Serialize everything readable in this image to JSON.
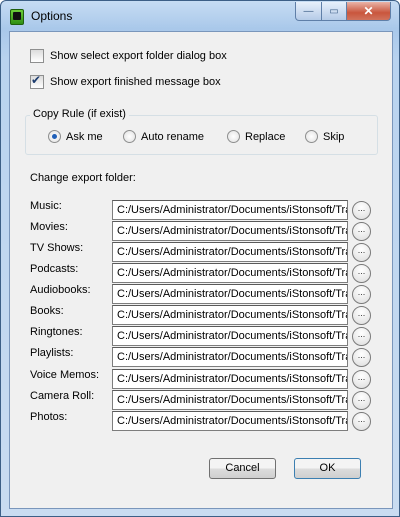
{
  "window": {
    "title": "Options"
  },
  "caption": {
    "minimize": "—",
    "maximize": "▭",
    "close": "✕"
  },
  "options": {
    "show_folder_dialog": {
      "label": "Show select export folder dialog box",
      "checked": false
    },
    "show_finished_msg": {
      "label": "Show export finished message box",
      "checked": true
    }
  },
  "copy_rule": {
    "label": "Copy Rule (if exist)",
    "options": [
      {
        "label": "Ask me",
        "selected": true
      },
      {
        "label": "Auto rename",
        "selected": false
      },
      {
        "label": "Replace",
        "selected": false
      },
      {
        "label": "Skip",
        "selected": false
      }
    ]
  },
  "export": {
    "label": "Change export folder:",
    "browse_label": "...",
    "folders": [
      {
        "label": "Music:",
        "path": "C:/Users/Administrator/Documents/iStonsoft/Transfer"
      },
      {
        "label": "Movies:",
        "path": "C:/Users/Administrator/Documents/iStonsoft/Transfer"
      },
      {
        "label": "TV Shows:",
        "path": "C:/Users/Administrator/Documents/iStonsoft/Transfer"
      },
      {
        "label": "Podcasts:",
        "path": "C:/Users/Administrator/Documents/iStonsoft/Transfer"
      },
      {
        "label": "Audiobooks:",
        "path": "C:/Users/Administrator/Documents/iStonsoft/Transfer"
      },
      {
        "label": "Books:",
        "path": "C:/Users/Administrator/Documents/iStonsoft/Transfer"
      },
      {
        "label": "Ringtones:",
        "path": "C:/Users/Administrator/Documents/iStonsoft/Transfer"
      },
      {
        "label": "Playlists:",
        "path": "C:/Users/Administrator/Documents/iStonsoft/Transfer"
      },
      {
        "label": "Voice Memos:",
        "path": "C:/Users/Administrator/Documents/iStonsoft/Transfer"
      },
      {
        "label": "Camera Roll:",
        "path": "C:/Users/Administrator/Documents/iStonsoft/Transfer"
      },
      {
        "label": "Photos:",
        "path": "C:/Users/Administrator/Documents/iStonsoft/Transfer"
      }
    ]
  },
  "buttons": {
    "cancel": "Cancel",
    "ok": "OK"
  }
}
